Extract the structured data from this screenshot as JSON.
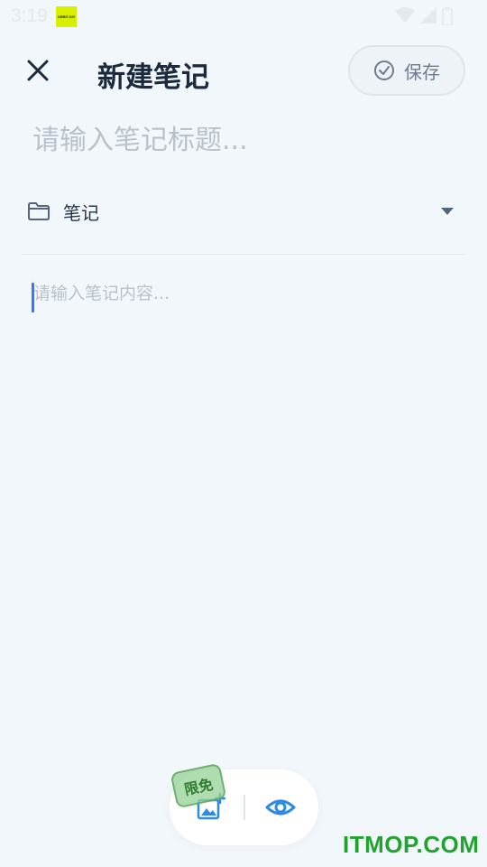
{
  "status_bar": {
    "time": "3:19",
    "logo_text": "ORBIT.DIY"
  },
  "header": {
    "title": "新建笔记",
    "save_label": "保存"
  },
  "note": {
    "title_placeholder": "请输入笔记标题...",
    "title_value": "",
    "category": "笔记",
    "content_placeholder": "请输入笔记内容...",
    "content_value": ""
  },
  "toolbar": {
    "badge": "限免"
  },
  "watermark": "ITMOP.COM",
  "icons": [
    "close-icon",
    "check-circle-icon",
    "folder-icon",
    "caret-down-icon",
    "image-add-icon",
    "eye-icon",
    "wifi-icon",
    "signal-icon",
    "battery-icon"
  ],
  "colors": {
    "background": "#f2f7fb",
    "accent": "#2e8ae6",
    "title": "#1c2a3e",
    "placeholder": "#b9c1cb",
    "badge": "#2f7d33",
    "watermark": "#22a32f"
  }
}
